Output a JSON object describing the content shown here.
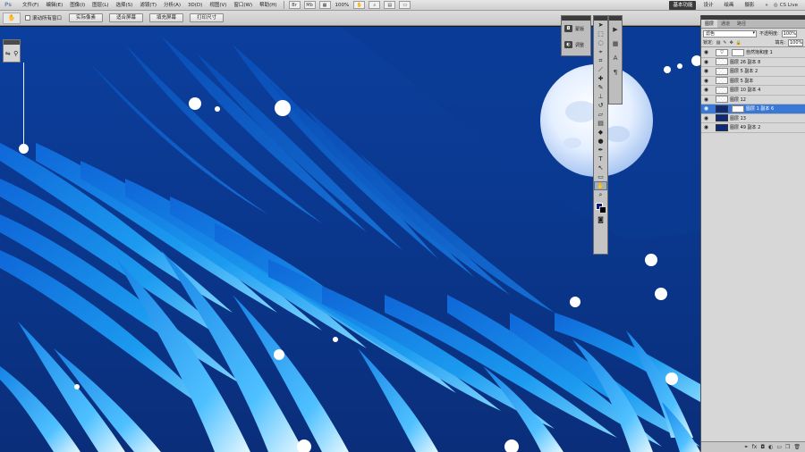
{
  "menubar": {
    "logo": "Ps",
    "items": [
      "文件(F)",
      "编辑(E)",
      "图像(I)",
      "图层(L)",
      "选择(S)",
      "滤镜(T)",
      "分析(A)",
      "3D(D)",
      "视图(V)",
      "窗口(W)",
      "帮助(H)"
    ],
    "zoom": "100%",
    "workspaces": [
      "基本功能",
      "设计",
      "绘画",
      "摄影"
    ],
    "workspace_more": "»",
    "cslive": "CS Live"
  },
  "options": {
    "tool_icon": "hand-icon",
    "scroll_all_label": "滚动所有窗口",
    "buttons": [
      "实际像素",
      "适合屏幕",
      "填充屏幕",
      "打印尺寸"
    ]
  },
  "adjust_panel": {
    "items": [
      {
        "icon": "masks-icon",
        "label": "蒙版"
      },
      {
        "icon": "adjustments-icon",
        "label": "调整"
      }
    ]
  },
  "toolbox": {
    "tools": [
      "➤",
      "⬚",
      "◌",
      "⌖",
      "⟋",
      "✎",
      "⊕",
      "✐",
      "⎘",
      "⊗",
      "▤",
      "◐",
      "◗",
      "✒",
      "T",
      "↖",
      "▭",
      "✋",
      "🔍"
    ],
    "active_index": 17,
    "foreground_color": "#0b1a80",
    "background_color": "#000000"
  },
  "layers_panel": {
    "tabs": [
      "图层",
      "通道",
      "路径"
    ],
    "blend_mode": "滤色",
    "opacity_label": "不透明度:",
    "opacity_value": "100%",
    "lock_label": "锁定:",
    "fill_label": "填充:",
    "fill_value": "100%",
    "layers": [
      {
        "name": "自然饱和度 1",
        "thumb": "adj"
      },
      {
        "name": "图层 26 副本 8",
        "thumb": "checker"
      },
      {
        "name": "图层 5 副本 2",
        "thumb": "checker"
      },
      {
        "name": "图层 5 副本",
        "thumb": "checker"
      },
      {
        "name": "图层 10 副本 4",
        "thumb": "checker"
      },
      {
        "name": "图层 12",
        "thumb": "checker"
      },
      {
        "name": "图层 1 副本 6",
        "thumb": "dark-mask",
        "selected": true
      },
      {
        "name": "图层 13",
        "thumb": "dark"
      },
      {
        "name": "图层 49 副本 2",
        "thumb": "dark"
      }
    ],
    "footer_icons": [
      "link-icon",
      "fx-icon",
      "mask-icon",
      "adjustment-icon",
      "folder-icon",
      "new-layer-icon",
      "trash-icon"
    ]
  },
  "colors": {
    "canvas_bg": "#0a3f9a",
    "selection": "#3a78d8"
  }
}
